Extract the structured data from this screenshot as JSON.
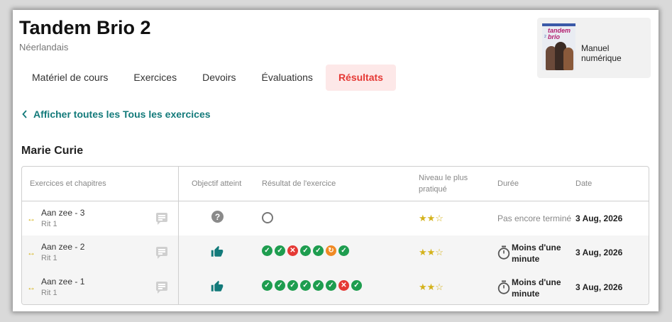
{
  "app": {
    "title": "Tandem Brio 2",
    "language": "Néerlandais"
  },
  "book": {
    "label": "Manuel numérique",
    "cover_title": "tandem brio",
    "cover_number": "2"
  },
  "tabs": [
    {
      "label": "Matériel de cours",
      "active": false
    },
    {
      "label": "Exercices",
      "active": false
    },
    {
      "label": "Devoirs",
      "active": false
    },
    {
      "label": "Évaluations",
      "active": false
    },
    {
      "label": "Résultats",
      "active": true
    }
  ],
  "back_link": "Afficher toutes les Tous les exercices",
  "student_name": "Marie Curie",
  "table": {
    "headers": {
      "exercise": "Exercices et chapitres",
      "goal": "Objectif atteint",
      "result": "Résultat de l'exercice",
      "level": "Niveau le plus pratiqué",
      "duration": "Durée",
      "date": "Date"
    },
    "rows": [
      {
        "name": "Aan zee - 3",
        "chapter": "Rit 1",
        "goal": "question",
        "results": [],
        "stars": 2,
        "stars_max": 3,
        "duration": "Pas encore terminé",
        "duration_type": "text",
        "date": "3 Aug, 2026"
      },
      {
        "name": "Aan zee - 2",
        "chapter": "Rit 1",
        "goal": "thumbs-up",
        "results": [
          "correct",
          "correct",
          "wrong",
          "correct",
          "correct",
          "retry",
          "correct"
        ],
        "stars": 2,
        "stars_max": 3,
        "duration": "Moins d'une minute",
        "duration_type": "timer",
        "date": "3 Aug, 2026"
      },
      {
        "name": "Aan zee - 1",
        "chapter": "Rit 1",
        "goal": "thumbs-up",
        "results": [
          "correct",
          "correct",
          "correct",
          "correct",
          "correct",
          "correct",
          "wrong",
          "correct"
        ],
        "stars": 2,
        "stars_max": 3,
        "duration": "Moins d'une minute",
        "duration_type": "timer",
        "date": "3 Aug, 2026"
      }
    ]
  },
  "colors": {
    "accent_teal": "#137a7a",
    "active_tab_text": "#e53935",
    "active_tab_bg": "#fde8e8",
    "correct": "#1e9d4f",
    "wrong": "#e53935",
    "retry": "#f08a24",
    "star": "#d4b21b"
  }
}
